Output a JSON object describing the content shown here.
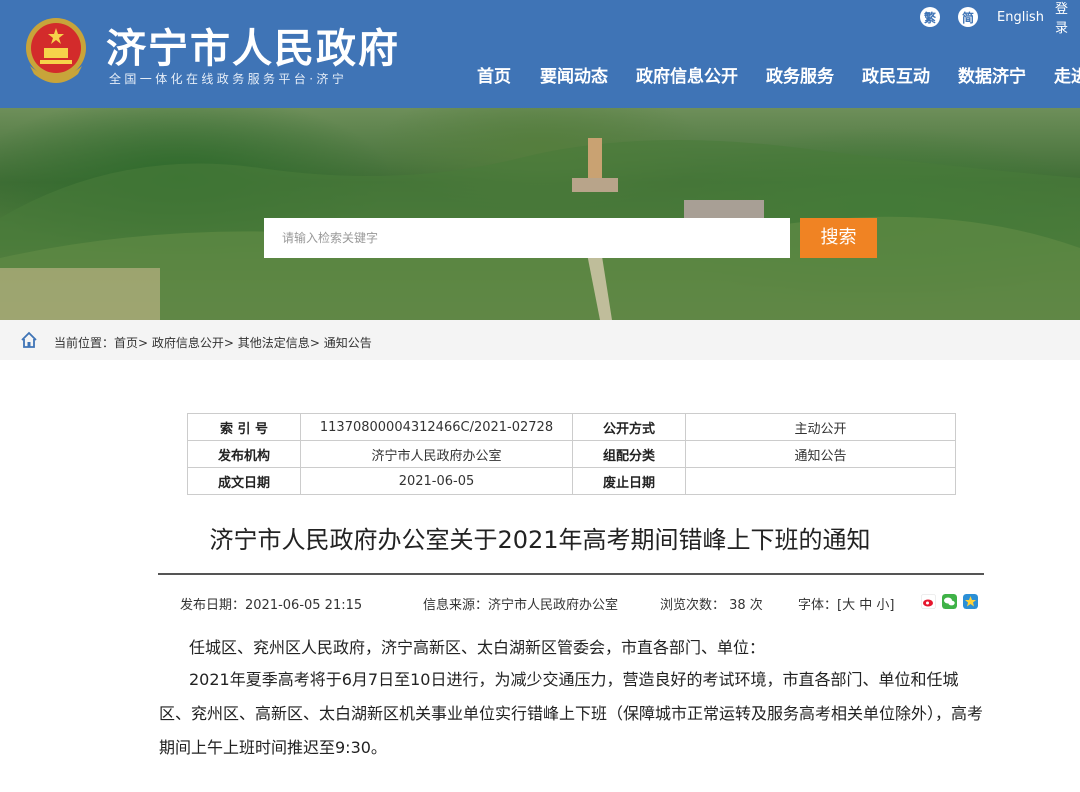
{
  "header": {
    "title": "济宁市人民政府",
    "subtitle": "全国一体化在线政务服务平台·济宁",
    "lang": {
      "traditional": "繁",
      "simplified": "简",
      "english": "English",
      "login": "登录"
    },
    "nav": [
      "首页",
      "要闻动态",
      "政府信息公开",
      "政务服务",
      "政民互动",
      "数据济宁",
      "走进济宁"
    ]
  },
  "search": {
    "placeholder": "请输入检索关键字",
    "button": "搜索"
  },
  "breadcrumb": {
    "label": "当前位置：",
    "items": [
      "首页",
      "政府信息公开",
      "其他法定信息",
      "通知公告"
    ]
  },
  "info": {
    "index_label": "索 引 号",
    "index_value": "11370800004312466C/2021-02728",
    "open_label": "公开方式",
    "open_value": "主动公开",
    "publisher_label": "发布机构",
    "publisher_value": "济宁市人民政府办公室",
    "category_label": "组配分类",
    "category_value": "通知公告",
    "date_label": "成文日期",
    "date_value": "2021-06-05",
    "expire_label": "废止日期",
    "expire_value": ""
  },
  "article": {
    "title": "济宁市人民政府办公室关于2021年高考期间错峰上下班的通知",
    "publish_date": "发布日期：2021-06-05 21:15",
    "source": "信息来源：济宁市人民政府办公室",
    "views": "浏览次数：  38 次",
    "font": "字体：[大 中 小]",
    "salutation": "任城区、兖州区人民政府，济宁高新区、太白湖新区管委会，市直各部门、单位：",
    "body": "2021年夏季高考将于6月7日至10日进行，为减少交通压力，营造良好的考试环境，市直各部门、单位和任城区、兖州区、高新区、太白湖新区机关事业单位实行错峰上下班（保障城市正常运转及服务高考相关单位除外），高考期间上午上班时间推迟至9:30。"
  },
  "colors": {
    "header_bg": "#3f74b6",
    "search_button": "#f08323"
  }
}
